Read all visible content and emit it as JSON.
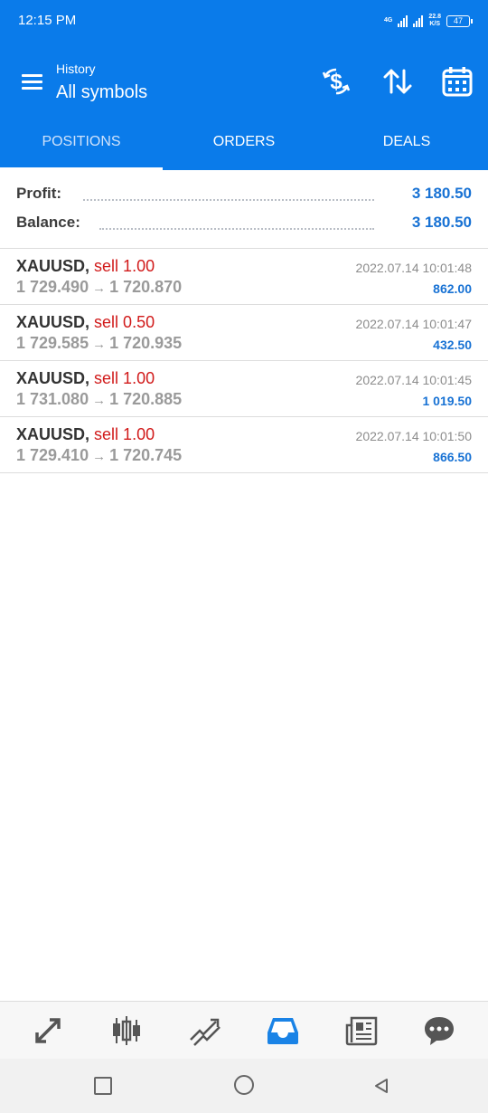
{
  "status_bar": {
    "time": "12:15 PM",
    "network": "4G",
    "speed_value": "22.8",
    "speed_unit": "K/S",
    "battery": "47"
  },
  "header": {
    "subtitle": "History",
    "title": "All symbols",
    "icons": [
      "menu-icon",
      "currency-refresh-icon",
      "sort-icon",
      "calendar-icon"
    ]
  },
  "tabs": [
    {
      "label": "POSITIONS",
      "active": true
    },
    {
      "label": "ORDERS",
      "active": false
    },
    {
      "label": "DEALS",
      "active": false
    }
  ],
  "summary": {
    "profit_label": "Profit:",
    "profit_value": "3 180.50",
    "balance_label": "Balance:",
    "balance_value": "3 180.50"
  },
  "positions": [
    {
      "symbol": "XAUUSD",
      "separator": ",",
      "action": "sell 1.00",
      "open_price": "1 729.490",
      "arrow": "→",
      "close_price": "1 720.870",
      "time": "2022.07.14 10:01:48",
      "profit": "862.00"
    },
    {
      "symbol": "XAUUSD",
      "separator": ",",
      "action": "sell 0.50",
      "open_price": "1 729.585",
      "arrow": "→",
      "close_price": "1 720.935",
      "time": "2022.07.14 10:01:47",
      "profit": "432.50"
    },
    {
      "symbol": "XAUUSD",
      "separator": ",",
      "action": "sell 1.00",
      "open_price": "1 731.080",
      "arrow": "→",
      "close_price": "1 720.885",
      "time": "2022.07.14 10:01:45",
      "profit": "1 019.50"
    },
    {
      "symbol": "XAUUSD",
      "separator": ",",
      "action": "sell 1.00",
      "open_price": "1 729.410",
      "arrow": "→",
      "close_price": "1 720.745",
      "time": "2022.07.14 10:01:50",
      "profit": "866.50"
    }
  ],
  "bottom_nav": [
    {
      "icon": "quotes-arrows-icon",
      "active": false
    },
    {
      "icon": "chart-candles-icon",
      "active": false
    },
    {
      "icon": "trade-icon",
      "active": false
    },
    {
      "icon": "history-inbox-icon",
      "active": true
    },
    {
      "icon": "news-icon",
      "active": false
    },
    {
      "icon": "chat-icon",
      "active": false
    }
  ],
  "colors": {
    "primary": "#0a7bea",
    "sell": "#d11a1a",
    "profit": "#1872d4",
    "muted": "#9a9a9a"
  }
}
